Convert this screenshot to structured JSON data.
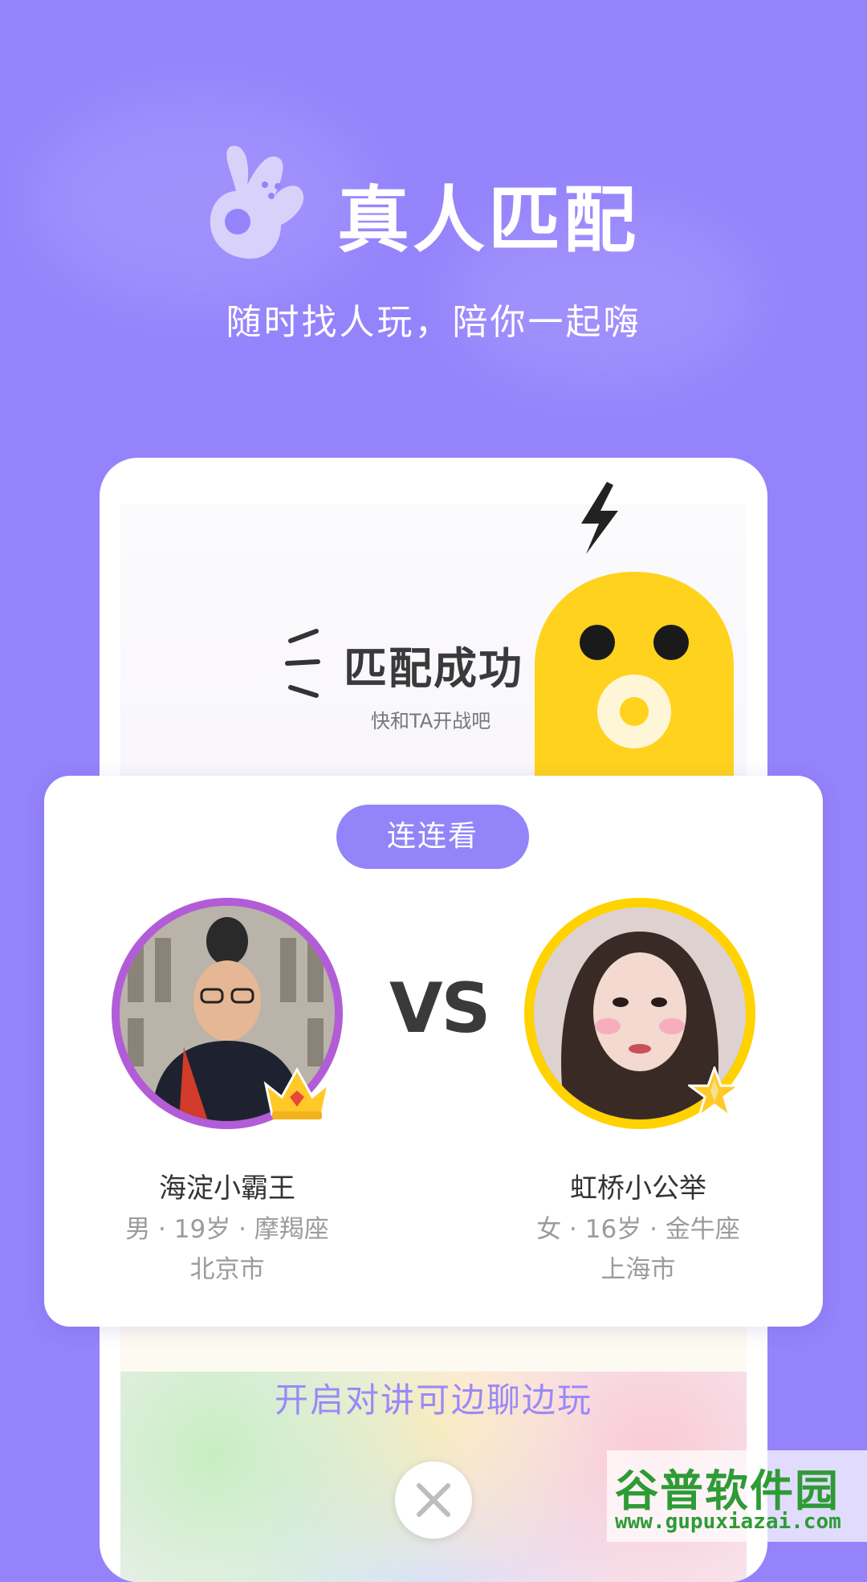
{
  "hero": {
    "title": "真人匹配",
    "subtitle": "随时找人玩，陪你一起嗨"
  },
  "match": {
    "title": "匹配成功",
    "subtitle": "快和TA开战吧"
  },
  "game": {
    "name": "连连看",
    "vs": "VS"
  },
  "players": [
    {
      "name": "海淀小霸王",
      "info": "男 · 19岁 · 摩羯座",
      "city": "北京市",
      "badge": "crown-icon"
    },
    {
      "name": "虹桥小公举",
      "info": "女 · 16岁 · 金牛座",
      "city": "上海市",
      "badge": "star-icon"
    }
  ],
  "cta": "开启对讲可边聊边玩",
  "watermark": {
    "logo": "谷普软件园",
    "url": "www.gupuxiazai.com"
  },
  "colors": {
    "background": "#9483fb",
    "accent": "#9384f9",
    "left_ring": "#b25dd7",
    "right_ring": "#ffd200",
    "mascot": "#ffd21e"
  }
}
